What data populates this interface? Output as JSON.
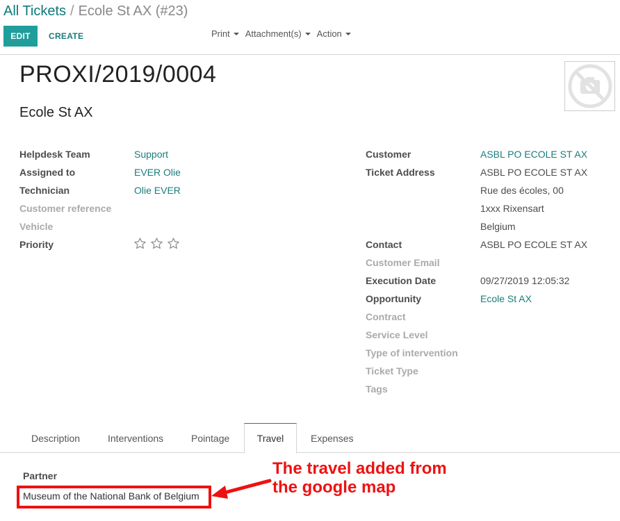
{
  "breadcrumb": {
    "parent": "All Tickets",
    "separator": "/",
    "current": "Ecole St AX (#23)"
  },
  "controls": {
    "edit_label": "EDIT",
    "create_label": "CREATE",
    "print_label": "Print",
    "attachments_label": "Attachment(s)",
    "action_label": "Action"
  },
  "record": {
    "name": "PROXI/2019/0004",
    "subtitle": "Ecole St AX"
  },
  "left_fields": {
    "helpdesk_team": {
      "label": "Helpdesk Team",
      "value": "Support"
    },
    "assigned_to": {
      "label": "Assigned to",
      "value": "EVER Olie"
    },
    "technician": {
      "label": "Technician",
      "value": "Olie EVER"
    },
    "customer_reference": {
      "label": "Customer reference"
    },
    "vehicle": {
      "label": "Vehicle"
    },
    "priority": {
      "label": "Priority",
      "stars": 0,
      "max_stars": 3
    }
  },
  "right_fields": {
    "customer": {
      "label": "Customer",
      "value": "ASBL PO ECOLE ST AX"
    },
    "ticket_address": {
      "label": "Ticket Address",
      "line1": "ASBL PO ECOLE ST AX",
      "line2": "Rue des écoles, 00",
      "line3": "1xxx Rixensart",
      "line4": "Belgium"
    },
    "contact": {
      "label": "Contact",
      "value": "ASBL PO ECOLE ST AX"
    },
    "customer_email": {
      "label": "Customer Email"
    },
    "execution_date": {
      "label": "Execution Date",
      "value": "09/27/2019 12:05:32"
    },
    "opportunity": {
      "label": "Opportunity",
      "value": "Ecole St AX"
    },
    "contract": {
      "label": "Contract"
    },
    "service_level": {
      "label": "Service Level"
    },
    "type_of_intervention": {
      "label": "Type of intervention"
    },
    "ticket_type": {
      "label": "Ticket Type"
    },
    "tags": {
      "label": "Tags"
    }
  },
  "tabs": [
    {
      "label": "Description"
    },
    {
      "label": "Interventions"
    },
    {
      "label": "Pointage"
    },
    {
      "label": "Travel",
      "active": true
    },
    {
      "label": "Expenses"
    }
  ],
  "travel": {
    "partner_label": "Partner",
    "partner_value": "Museum of the National Bank of Belgium"
  },
  "annotation": {
    "line1": "The travel added from",
    "line2": "the google map",
    "color": "#ee1111"
  },
  "colors": {
    "accent": "#1f9e9c",
    "link": "#1a7c7a",
    "highlight": "#ee1111"
  }
}
